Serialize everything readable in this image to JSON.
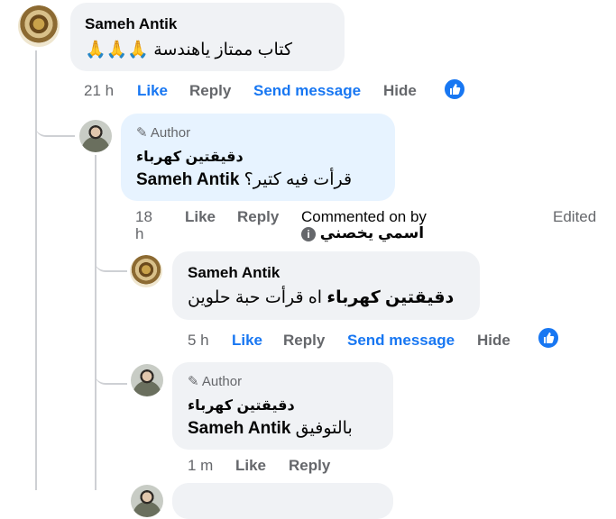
{
  "comment1": {
    "author": "Sameh Antik",
    "text": "كتاب ممتاز ياهندسة",
    "emoji": "🙏🙏🙏",
    "time": "21 h",
    "like": "Like",
    "reply": "Reply",
    "send_message": "Send message",
    "hide": "Hide",
    "reaction_icon": "thumbs-up-icon"
  },
  "reply1": {
    "author_tag": "Author",
    "author": "دقيقتين كهرباء",
    "mention": "Sameh Antik",
    "text": "قرأت فيه كتير؟",
    "time": "18 h",
    "like": "Like",
    "reply": "Reply",
    "commented_on_by": "Commented on by",
    "commenter": "اسمي يخصني",
    "edited": "Edited"
  },
  "reply2": {
    "author": "Sameh Antik",
    "mention": "دقيقتين كهرباء",
    "text": "اه قرأت حبة حلوين",
    "time": "5 h",
    "like": "Like",
    "reply": "Reply",
    "send_message": "Send message",
    "hide": "Hide",
    "reaction_icon": "thumbs-up-icon"
  },
  "reply3": {
    "author_tag": "Author",
    "author": "دقيقتين كهرباء",
    "mention": "Sameh Antik",
    "text": "بالتوفيق",
    "time": "1 m",
    "like": "Like",
    "reply": "Reply"
  },
  "colors": {
    "accent": "#1877f2",
    "meta": "#65676b",
    "bubble": "#f0f2f5",
    "author_bubble": "#e7f3ff"
  }
}
